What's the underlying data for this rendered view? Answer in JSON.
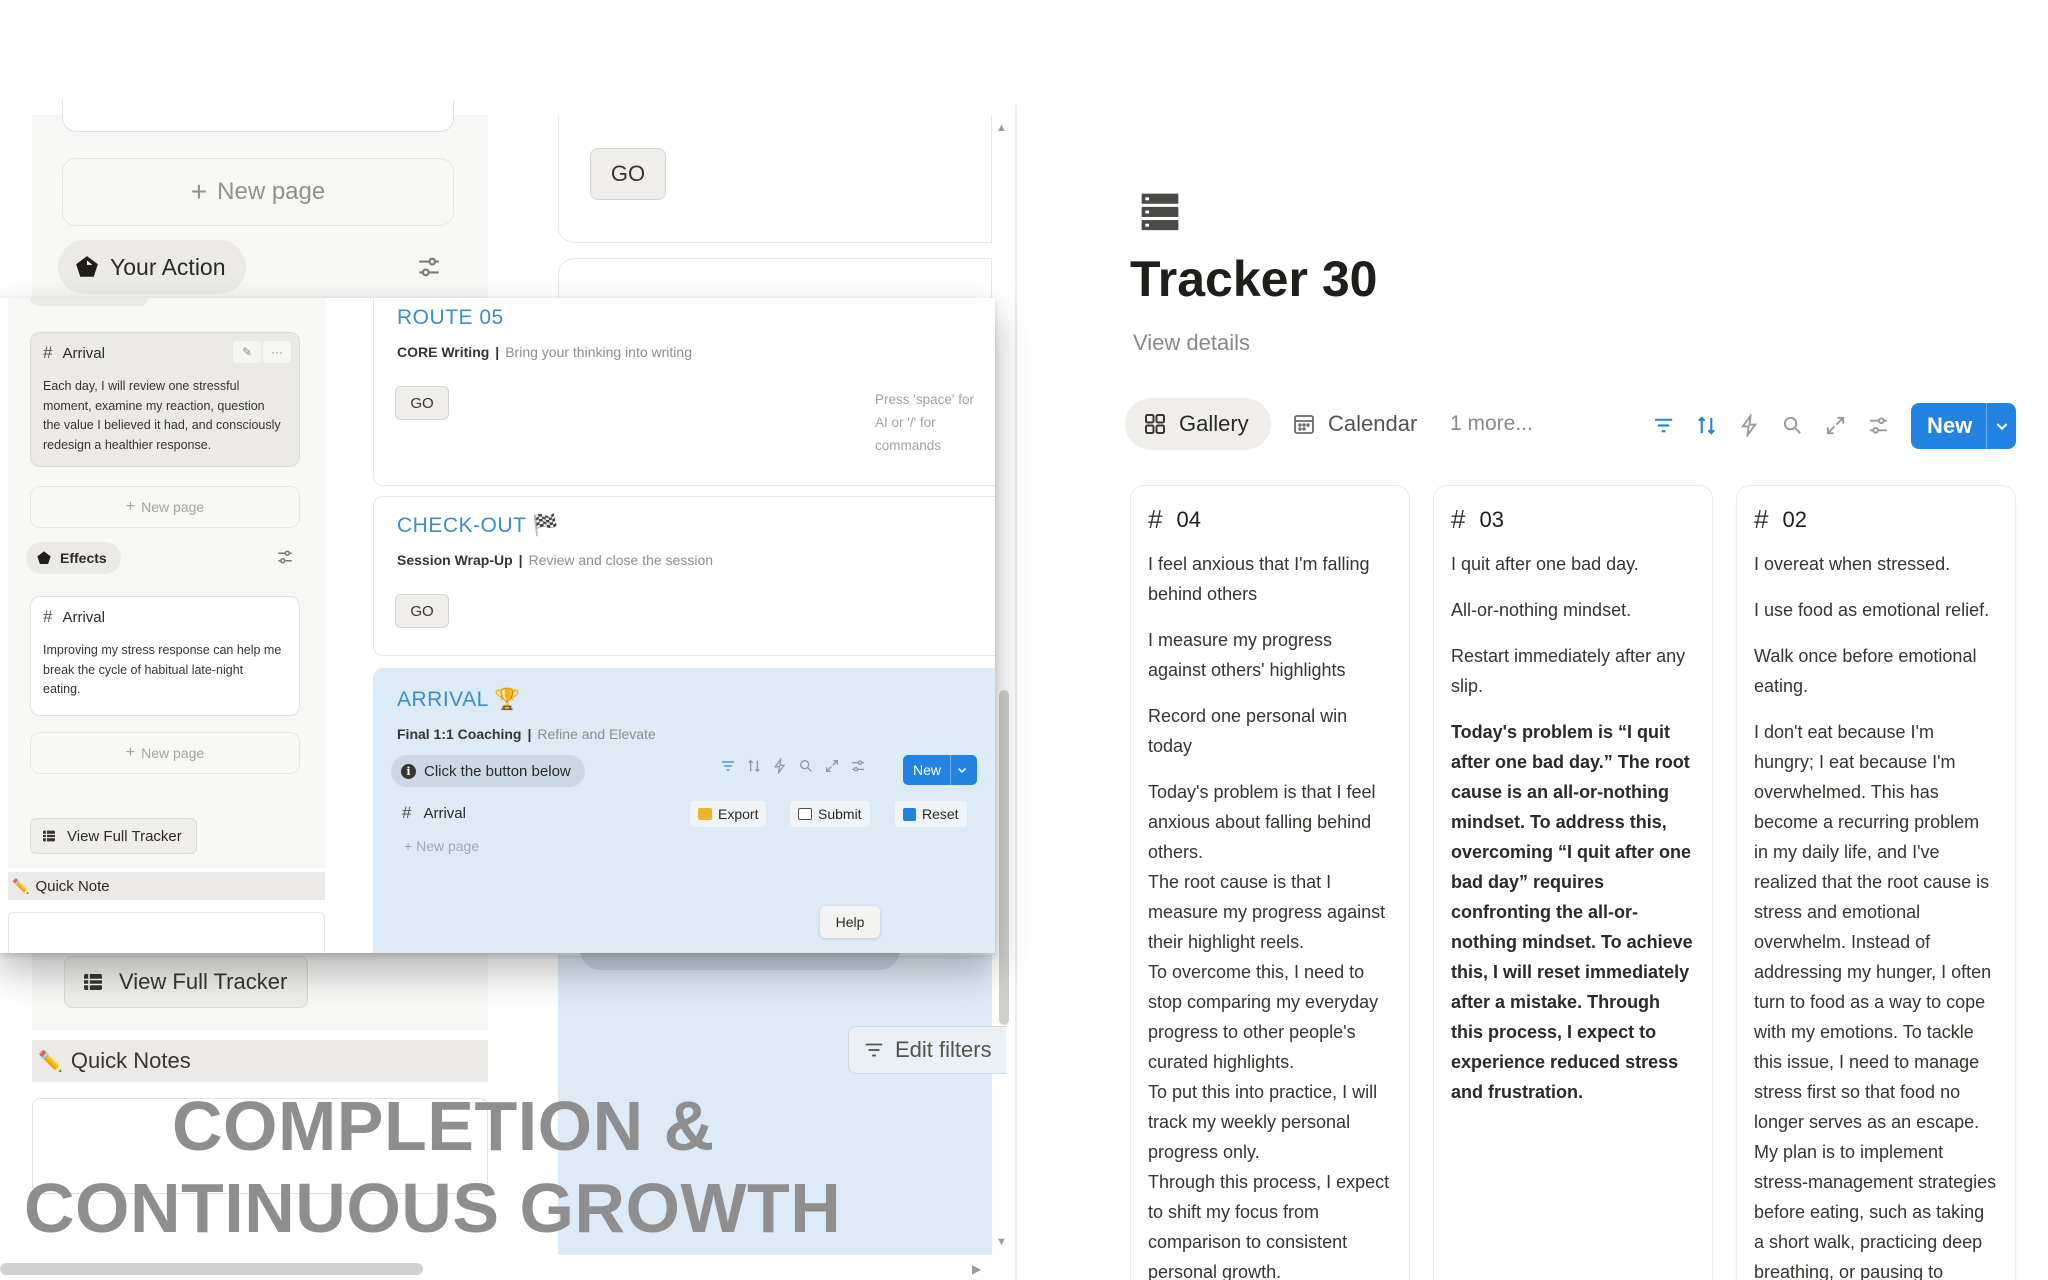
{
  "background_panel": {
    "new_page_label": "New page",
    "action_label": "Your Action",
    "go_label": "GO",
    "edit_filters_label": "Edit filters",
    "view_full_tracker_label": "View Full Tracker",
    "quick_notes_label": "Quick Notes"
  },
  "overlay": {
    "left": {
      "card1": {
        "title": "Arrival",
        "text": "Each day, I will review one stressful moment, examine my reaction, question the value I believed it had, and consciously redesign a healthier response."
      },
      "new_page_label": "New page",
      "effects_label": "Effects",
      "card2": {
        "title": "Arrival",
        "text": "Improving my stress response can help me break the cycle of habitual late-night eating."
      },
      "view_full_tracker_label": "View Full Tracker",
      "quick_note_label": "Quick Note"
    },
    "route": {
      "title": "ROUTE 05",
      "subtitle_bold": "CORE Writing",
      "subtitle_muted": "Bring your thinking into writing",
      "go_label": "GO",
      "hint": "Press 'space' for AI or '/' for commands"
    },
    "checkout": {
      "title": "CHECK-OUT 🏁",
      "subtitle_bold": "Session Wrap-Up",
      "subtitle_muted": "Review and close the session",
      "go_label": "GO"
    },
    "arrival": {
      "title": "ARRIVAL 🏆",
      "subtitle_bold": "Final 1:1 Coaching",
      "subtitle_muted": "Refine and Elevate",
      "click_label": "Click the button below",
      "new_label": "New",
      "row_title": "Arrival",
      "export_label": "Export",
      "submit_label": "Submit",
      "reset_label": "Reset",
      "new_page_label": "New page",
      "help_label": "Help"
    }
  },
  "headline": {
    "line1": "COMPLETION &",
    "line2": "CONTINUOUS GROWTH"
  },
  "database": {
    "title": "Tracker 30",
    "view_details": "View details",
    "tabs": {
      "gallery": "Gallery",
      "calendar": "Calendar",
      "more": "1 more..."
    },
    "new_label": "New",
    "cards": [
      {
        "number": "04",
        "paragraphs": [
          "I feel anxious that I'm falling behind others",
          "I measure my progress against others' highlights",
          "Record one personal win today"
        ],
        "body": [
          "Today's problem is that I feel anxious about falling behind others.",
          "The root cause is that I measure my progress against their highlight reels.",
          "To overcome this, I need to stop comparing my everyday progress to other people's curated highlights.",
          "To put this into practice, I will track my weekly personal progress only.",
          "Through this process, I expect to shift my focus from comparison to consistent personal growth."
        ]
      },
      {
        "number": "03",
        "paragraphs": [
          "I quit after one bad day.",
          "All-or-nothing mindset.",
          "Restart immediately after any slip."
        ],
        "bold_body": "Today's problem is “I quit after one bad day.” The root cause is an all-or-nothing mindset. To address this, overcoming “I quit after one bad day” requires confronting the all-or-nothing mindset. To achieve this, I will reset immediately after a mistake. Through this process, I expect to experience reduced stress and frustration."
      },
      {
        "number": "02",
        "paragraphs": [
          "I overeat when stressed.",
          "I use food as emotional relief.",
          "Walk once before emotional eating."
        ],
        "body": [
          "I don't eat because I'm hungry; I eat because I'm overwhelmed. This has become a recurring problem in my daily life, and I've realized that the root cause is stress and emotional overwhelm. Instead of addressing my hunger, I often turn to food as a way to cope with my emotions. To tackle this issue, I need to manage stress first so that food no longer serves as an escape.",
          "My plan is to implement stress-management strategies before eating, such as taking a short walk, practicing deep breathing, or pausing to"
        ]
      }
    ]
  }
}
